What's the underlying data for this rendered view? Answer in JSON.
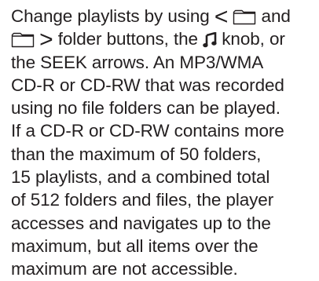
{
  "paragraph": {
    "l1_a": "Change playlists by using ",
    "l1_b": " and",
    "l2_a": " folder buttons, the ",
    "l2_b": " knob, or",
    "lines": [
      "the SEEK arrows. An MP3/WMA",
      "CD-R or CD-RW that was recorded",
      "using no file folders can be played.",
      "If a CD-R or CD-RW contains more",
      "than the maximum of 50 folders,",
      "15 playlists, and a combined total",
      "of 512 folders and files, the player",
      "accesses and navigates up to the",
      "maximum, but all items over the",
      "maximum are not accessible."
    ]
  },
  "glyphs": {
    "left_arrow": "<",
    "right_arrow": ">"
  },
  "icons": {
    "folder": "folder-icon",
    "music_note": "music-note-icon"
  },
  "colors": {
    "text": "#231f20",
    "background": "#ffffff"
  }
}
